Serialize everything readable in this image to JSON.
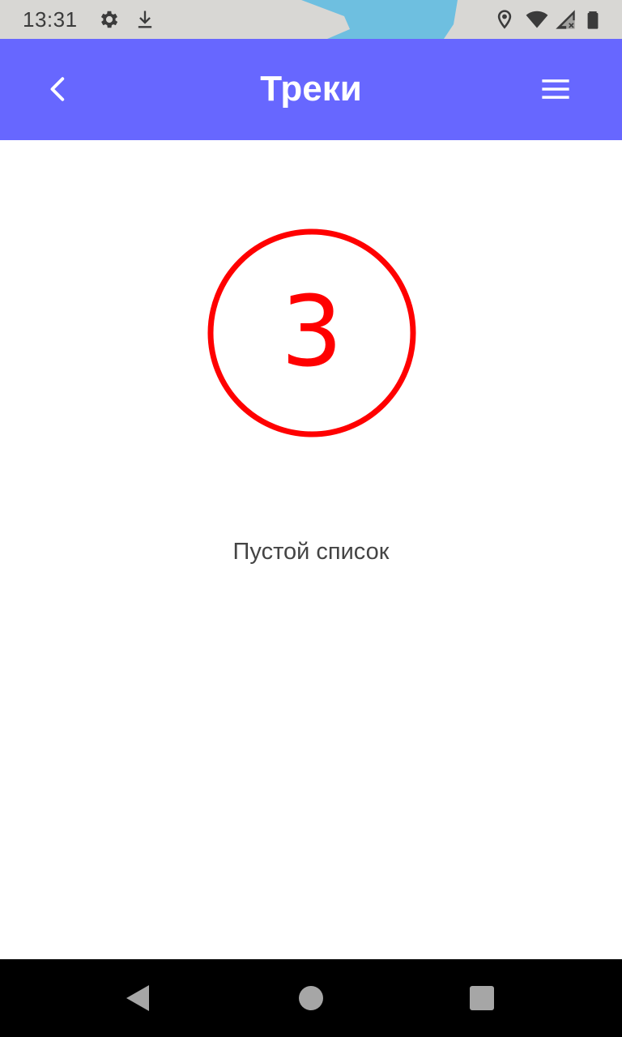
{
  "status_bar": {
    "time": "13:31",
    "icons_left": [
      "gear-icon",
      "download-icon"
    ],
    "icons_right": [
      "location-icon",
      "wifi-icon",
      "signal-icon",
      "battery-icon"
    ],
    "background_color": "#d8d7d4",
    "accent_color": "#6ebfe0"
  },
  "app_bar": {
    "title": "Треки",
    "back_icon": "chevron-left-icon",
    "menu_icon": "hamburger-menu-icon",
    "background_color": "#6767ff"
  },
  "empty_state": {
    "number": "3",
    "message": "Пустой список",
    "accent_color": "#ff0000"
  },
  "nav_bar": {
    "icons": [
      "back-triangle-icon",
      "home-circle-icon",
      "recents-square-icon"
    ]
  }
}
